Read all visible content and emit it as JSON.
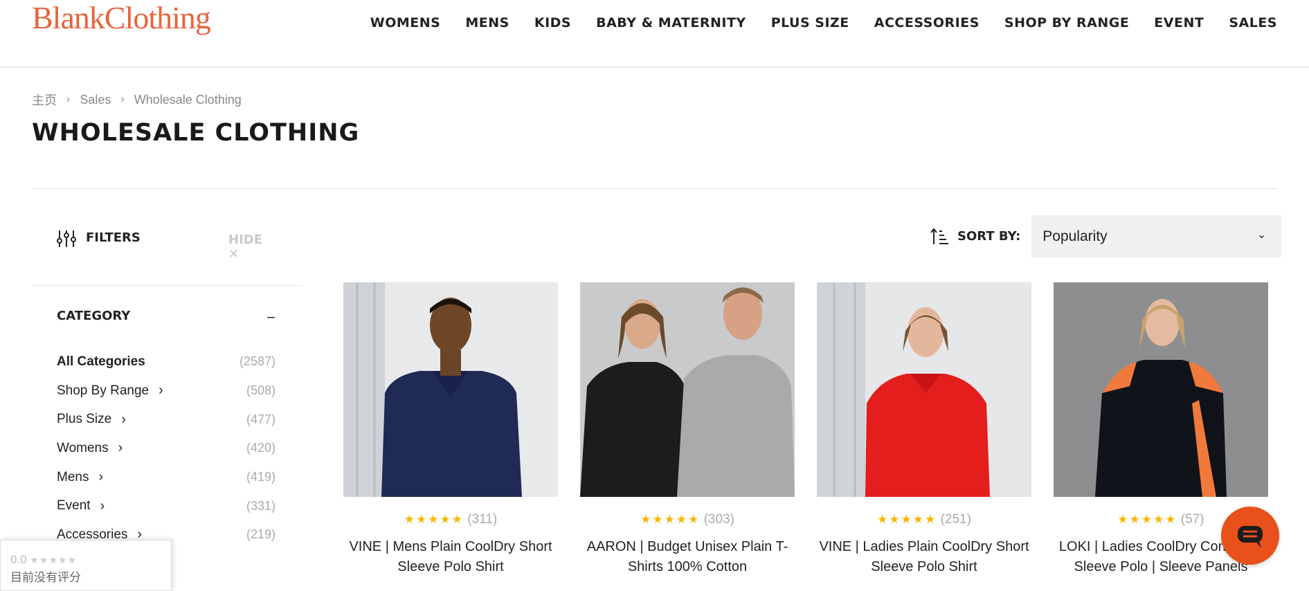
{
  "header": {
    "logo": "BlankClothing",
    "nav": [
      "WOMENS",
      "MENS",
      "KIDS",
      "BABY & MATERNITY",
      "PLUS SIZE",
      "ACCESSORIES",
      "SHOP BY RANGE",
      "EVENT",
      "SALES"
    ]
  },
  "breadcrumb": [
    "主页",
    "Sales",
    "Wholesale Clothing"
  ],
  "page_title": "WHOLESALE CLOTHING",
  "filters": {
    "label": "FILTERS",
    "hide": "HIDE",
    "category_title": "CATEGORY",
    "categories": [
      {
        "label": "All Categories",
        "count": "(2587)"
      },
      {
        "label": "Shop By Range",
        "count": "(508)"
      },
      {
        "label": "Plus Size",
        "count": "(477)"
      },
      {
        "label": "Womens",
        "count": "(420)"
      },
      {
        "label": "Mens",
        "count": "(419)"
      },
      {
        "label": "Event",
        "count": "(331)"
      },
      {
        "label": "Accessories",
        "count": "(219)"
      }
    ]
  },
  "sort": {
    "label": "SORT BY:",
    "value": "Popularity"
  },
  "products": [
    {
      "reviews": "(311)",
      "name": "VINE | Mens Plain CoolDry Short Sleeve Polo Shirt",
      "rating": 5
    },
    {
      "reviews": "(303)",
      "name": "AARON | Budget Unisex Plain T-Shirts 100% Cotton",
      "rating": 5
    },
    {
      "reviews": "(251)",
      "name": "VINE | Ladies Plain CoolDry Short Sleeve Polo Shirt",
      "rating": 5
    },
    {
      "reviews": "(57)",
      "name": "LOKI | Ladies CoolDry Con Short Sleeve Polo | Sleeve Panels",
      "rating": 5
    }
  ],
  "review_badge": {
    "score": "0.0",
    "text": "目前没有评分"
  },
  "colors": {
    "brand": "#e8643c",
    "chat": "#e8511c",
    "star": "#f5b800"
  }
}
